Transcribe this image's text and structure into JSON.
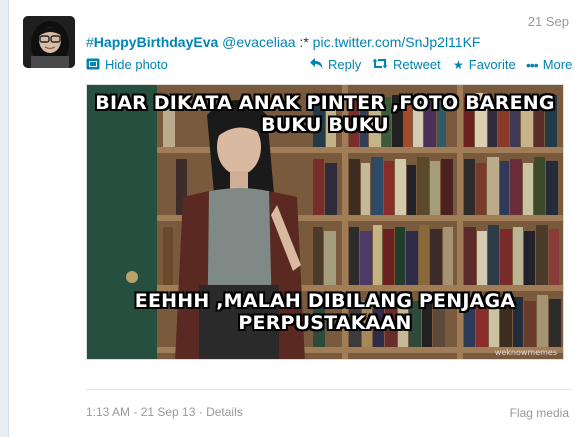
{
  "tweet": {
    "hashtag_symbol": "#",
    "hashtag_text": "HappyBirthdayEva",
    "mention": "@evaceliaa",
    "text": " :* ",
    "link": "pic.twitter.com/SnJp2l11KF",
    "time_right": "21 Sep",
    "actions": {
      "hide_photo": "Hide photo",
      "reply": "Reply",
      "retweet": "Retweet",
      "favorite": "Favorite",
      "more": "More"
    },
    "photo": {
      "top_text_line1": "BIAR DIKATA ANAK PINTER ,FOTO BARENG",
      "top_text_line2": "BUKU BUKU",
      "bottom_text_line1": "EEHHH ,MALAH DIBILANG PENJAGA",
      "bottom_text_line2": "PERPUSTAKAAN",
      "watermark": "weknowmemes"
    },
    "footer": {
      "timestamp": "1:13 AM - 21 Sep 13",
      "separator": " · ",
      "details": "Details",
      "flag": "Flag media"
    }
  },
  "colors": {
    "link": "#0084b4",
    "muted": "#999999",
    "text": "#333333"
  },
  "icons": [
    "avatar",
    "photo-icon",
    "reply-icon",
    "retweet-icon",
    "favorite-star-icon",
    "more-dots-icon"
  ]
}
